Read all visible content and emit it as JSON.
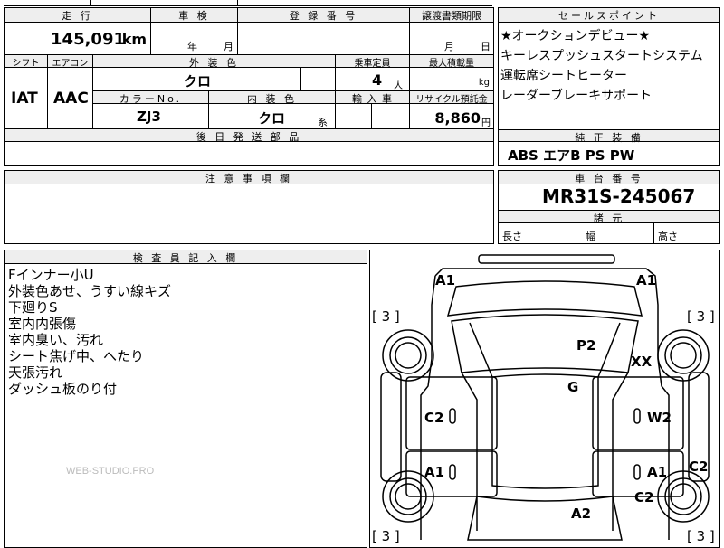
{
  "header": {
    "mileage_label": "走 行",
    "mileage_value": "145,091",
    "mileage_unit": "km",
    "inspection_label": "車 検",
    "inspection_year": "年",
    "inspection_month": "月",
    "registration_label": "登 録 番 号",
    "transfer_label": "譲渡書類期限",
    "transfer_month": "月",
    "transfer_day": "日"
  },
  "specs": {
    "shift_label": "シフト",
    "shift_value": "IAT",
    "ac_label": "エアコン",
    "ac_value": "AAC",
    "exterior_label": "外 装 色",
    "exterior_value": "クロ",
    "capacity_label": "乗車定員",
    "capacity_value": "4",
    "capacity_unit": "人",
    "max_load_label": "最大積載量",
    "max_load_unit": "kg",
    "color_no_label": "カラーNo.",
    "color_no_value": "ZJ3",
    "interior_label": "内 装 色",
    "interior_value": "クロ",
    "interior_suffix": "系",
    "import_label": "輸 入 車",
    "recycle_label": "リサイクル預託金",
    "recycle_value": "8,860",
    "recycle_unit": "円",
    "parts_label": "後 日 発 送 部 品"
  },
  "sales_points": {
    "label": "セールスポイント",
    "items": [
      "★オークションデビュー★",
      "キーレスプッシュスタートシステム",
      "運転席シートヒーター",
      "レーダーブレーキサポート"
    ]
  },
  "equipment": {
    "label": "純 正 装 備",
    "value": "ABS エアB PS PW"
  },
  "notes": {
    "label": "注 意 事 項 欄"
  },
  "chassis": {
    "label": "車 台 番 号",
    "value": "MR31S-245067",
    "dims_label": "諸 元",
    "length": "長さ",
    "width": "幅",
    "height": "高さ"
  },
  "inspector": {
    "label": "検 査 員 記 入 欄",
    "lines": [
      "Fインナー小U",
      "外装色あせ、うすい線キズ",
      "下廻りS",
      "室内内張傷",
      "室内臭い、汚れ",
      "シート焦げ中、へたり",
      "天張汚れ",
      "ダッシュ板のり付"
    ],
    "watermark": "WEB-STUDIO.PRO"
  },
  "diagram": {
    "marks": {
      "a1_tl": "A1",
      "a1_tr": "A1",
      "p2": "P2",
      "xx": "XX",
      "g": "G",
      "c2_l": "C2",
      "w2": "W2",
      "a1_ml": "A1",
      "a1_mr": "A1",
      "c2_r": "C2",
      "c2_br": "C2",
      "a2": "A2"
    },
    "tires": {
      "tl": "[ 3 ]",
      "tr": "[ 3 ]",
      "bl": "[ 3 ]",
      "br": "[ 3 ]"
    }
  }
}
